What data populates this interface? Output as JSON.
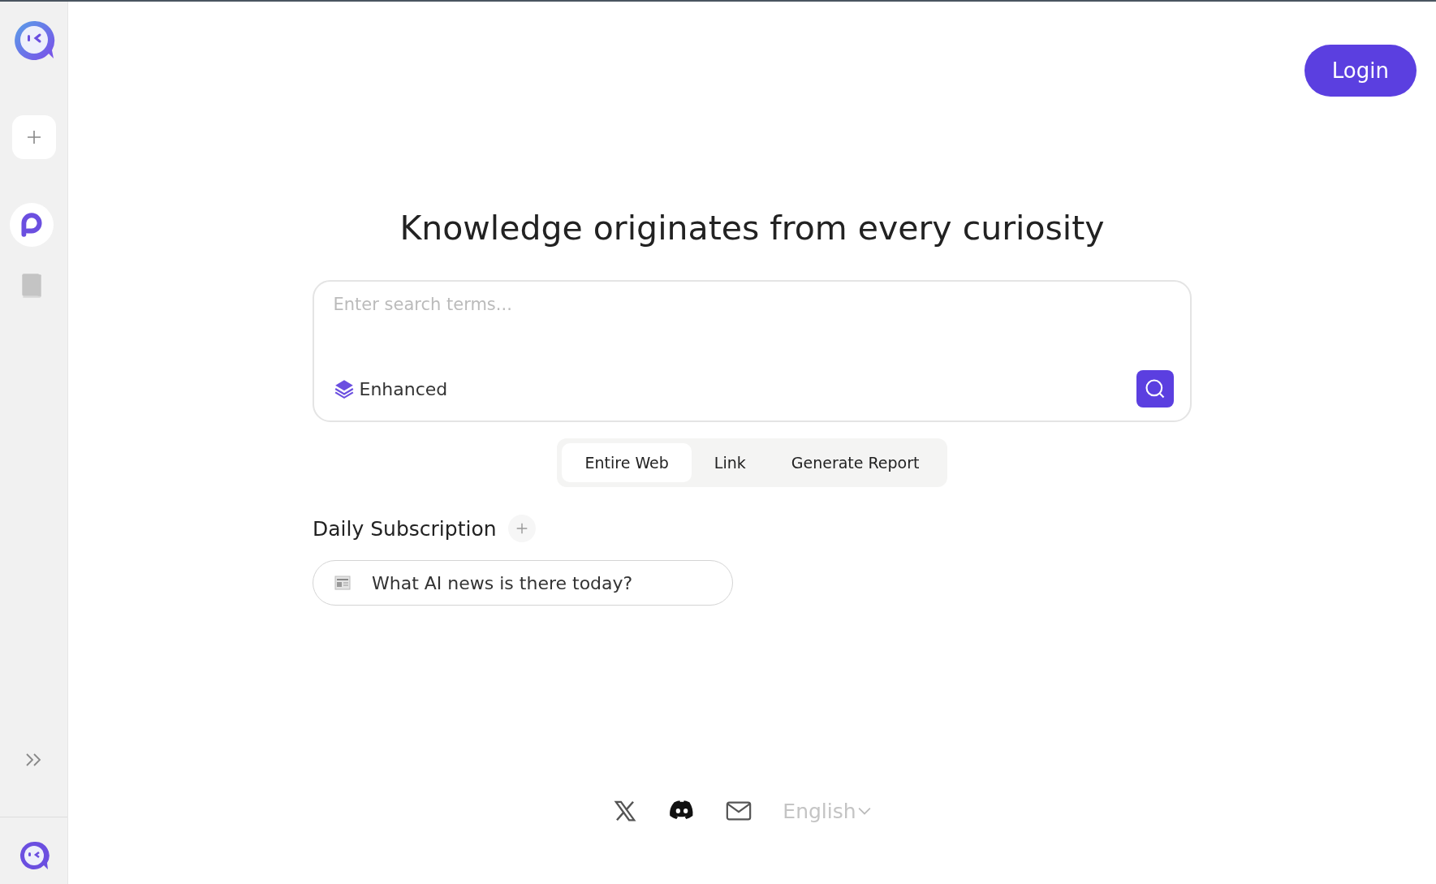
{
  "sidebar": {
    "nav": [
      {
        "kind": "search",
        "selected": true
      },
      {
        "kind": "library",
        "selected": false
      }
    ]
  },
  "header": {
    "login_button": "Login"
  },
  "headline": "Knowledge originates from every curiosity",
  "search": {
    "placeholder": "Enter search terms...",
    "mode": "Enhanced"
  },
  "tabs": [
    {
      "label": "Entire Web",
      "selected": true
    },
    {
      "label": "Link",
      "selected": false
    },
    {
      "label": "Generate Report",
      "selected": false
    }
  ],
  "subscription": {
    "title": "Daily Subscription",
    "items": [
      "What AI news is there today?"
    ]
  },
  "footer": {
    "language": "English"
  }
}
